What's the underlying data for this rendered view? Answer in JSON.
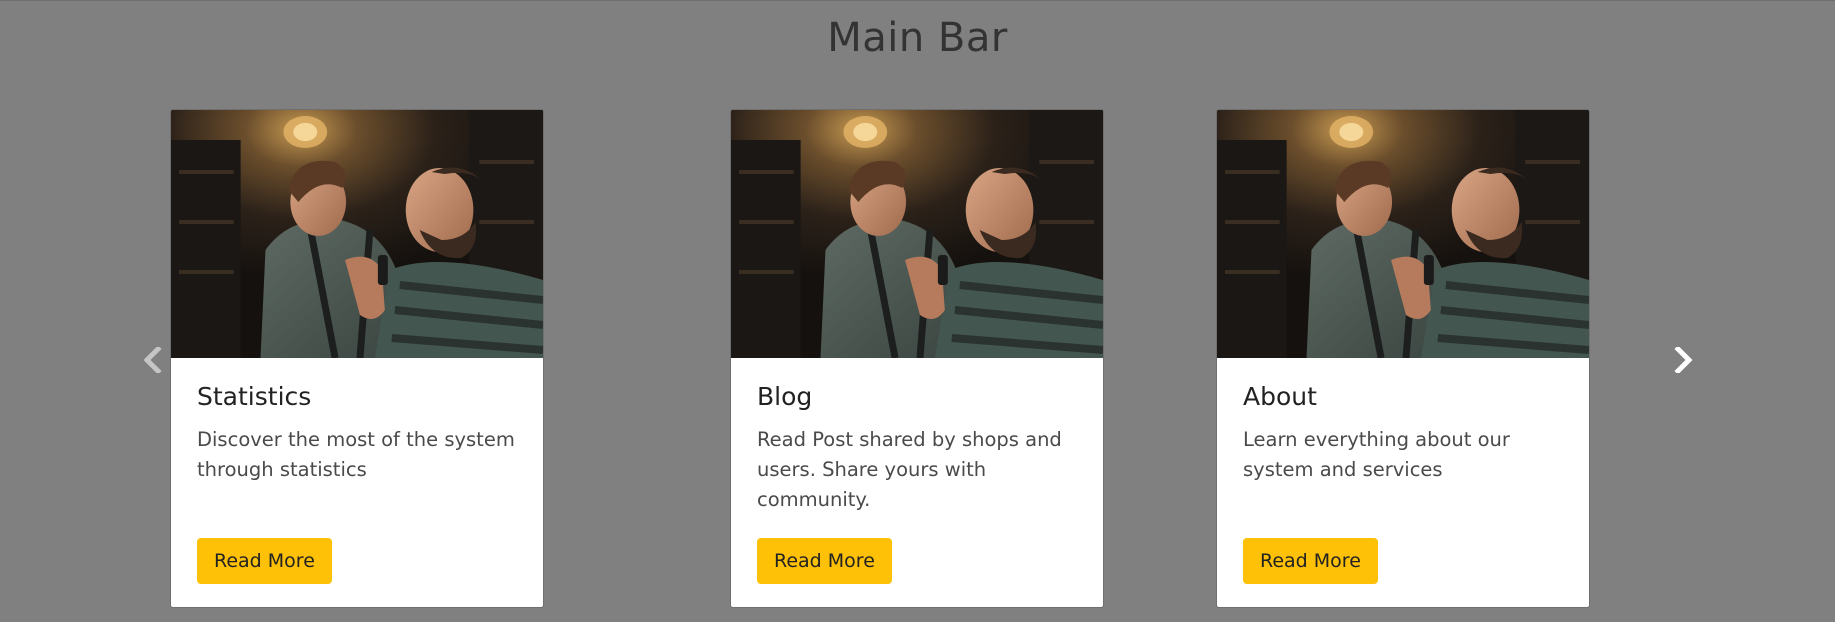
{
  "page": {
    "title": "Main Bar"
  },
  "carousel": {
    "prev_icon": "chevron-left-icon",
    "next_icon": "chevron-right-icon"
  },
  "cards": [
    {
      "title": "Statistics",
      "text": "Discover the most of the system through statistics",
      "button_label": "Read More"
    },
    {
      "title": "Blog",
      "text": "Read Post shared by shops and users. Share yours with community.",
      "button_label": "Read More"
    },
    {
      "title": "About",
      "text": "Learn everything about our system and services",
      "button_label": "Read More"
    }
  ],
  "colors": {
    "background": "#808080",
    "card": "#ffffff",
    "button": "#ffc107",
    "title": "#333333"
  },
  "image_subject": "barber-trimming-customer-beard"
}
